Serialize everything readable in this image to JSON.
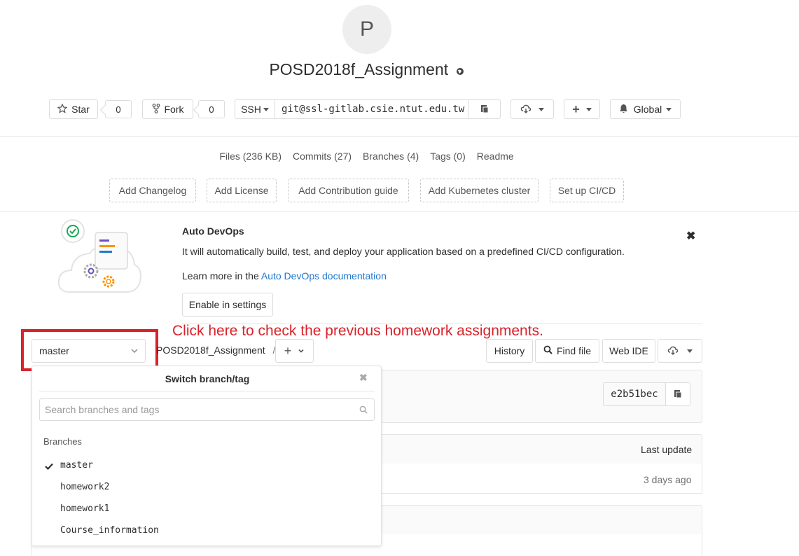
{
  "project": {
    "avatar_letter": "P",
    "name": "POSD2018f_Assignment"
  },
  "actions": {
    "star_label": "Star",
    "star_count": "0",
    "fork_label": "Fork",
    "fork_count": "0",
    "protocol_label": "SSH",
    "clone_url": "git@ssl-gitlab.csie.ntut.edu.tw",
    "notification_label": "Global"
  },
  "stats": [
    {
      "label": "Files (236 KB)"
    },
    {
      "label": "Commits (27)"
    },
    {
      "label": "Branches (4)"
    },
    {
      "label": "Tags (0)"
    },
    {
      "label": "Readme"
    }
  ],
  "add_buttons": [
    {
      "label": "Add Changelog"
    },
    {
      "label": "Add License"
    },
    {
      "label": "Add Contribution guide"
    },
    {
      "label": "Add Kubernetes cluster"
    },
    {
      "label": "Set up CI/CD"
    }
  ],
  "devops": {
    "title": "Auto DevOps",
    "description": "It will automatically build, test, and deploy your application based on a predefined CI/CD configuration.",
    "learn_prefix": "Learn more in the ",
    "learn_link": "Auto DevOps documentation",
    "enable_button": "Enable in settings"
  },
  "annotation": {
    "text": "Click here to check the previous homework assignments.",
    "color": "#d9222a"
  },
  "tree": {
    "branch_value": "master",
    "path": "POSD2018f_Assignment",
    "separator": "/",
    "history_label": "History",
    "find_file_label": "Find file",
    "web_ide_label": "Web IDE",
    "commit_sha": "e2b51bec",
    "last_update_header": "Last update",
    "last_update_value": "3 days ago"
  },
  "dropdown": {
    "title": "Switch branch/tag",
    "search_placeholder": "Search branches and tags",
    "section_label": "Branches",
    "branches": [
      {
        "name": "master",
        "selected": true
      },
      {
        "name": "homework2",
        "selected": false
      },
      {
        "name": "homework1",
        "selected": false
      },
      {
        "name": "Course_information",
        "selected": false
      }
    ]
  },
  "colors": {
    "link": "#1f78d1",
    "highlight_box": "#d9222a"
  }
}
